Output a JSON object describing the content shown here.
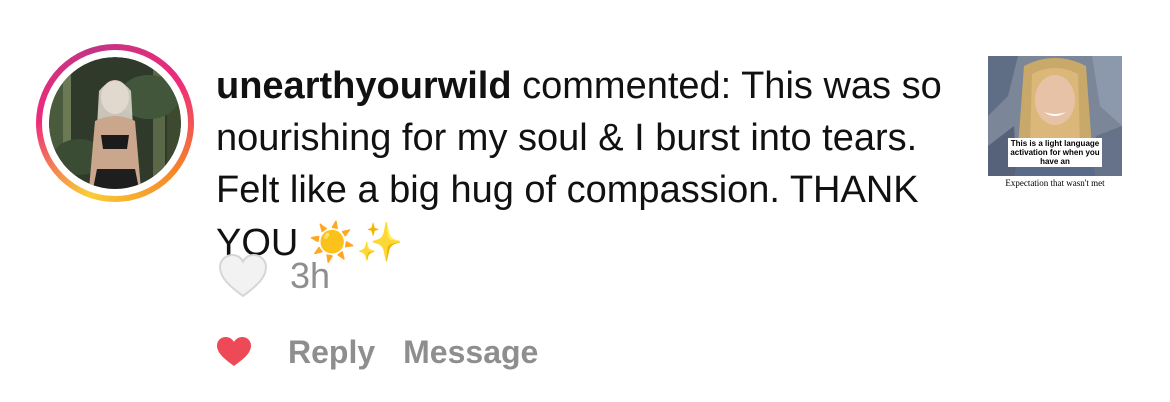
{
  "notification": {
    "username": "unearthyourwild",
    "action_text": " commented: This was so nourishing for my soul & I burst into tears. Felt like a big hug of compassion. THANK YOU ",
    "emojis": {
      "sun": "☀️",
      "sparkles": "✨"
    },
    "timestamp": "3h",
    "like_icon": "heart-outline-icon",
    "liked_icon": "heart-filled-icon",
    "liked_color": "#ed4956"
  },
  "actions": {
    "reply_label": "Reply",
    "message_label": "Message"
  },
  "post_thumbnail": {
    "caption": "This is a light language activation for when you have an",
    "subcaption": "Expectation that wasn't met"
  },
  "colors": {
    "primary_text": "#111111",
    "secondary_text": "#8e8e8e",
    "ring_gradient": [
      "#f9ce34",
      "#ee2a7b",
      "#c13584"
    ]
  }
}
